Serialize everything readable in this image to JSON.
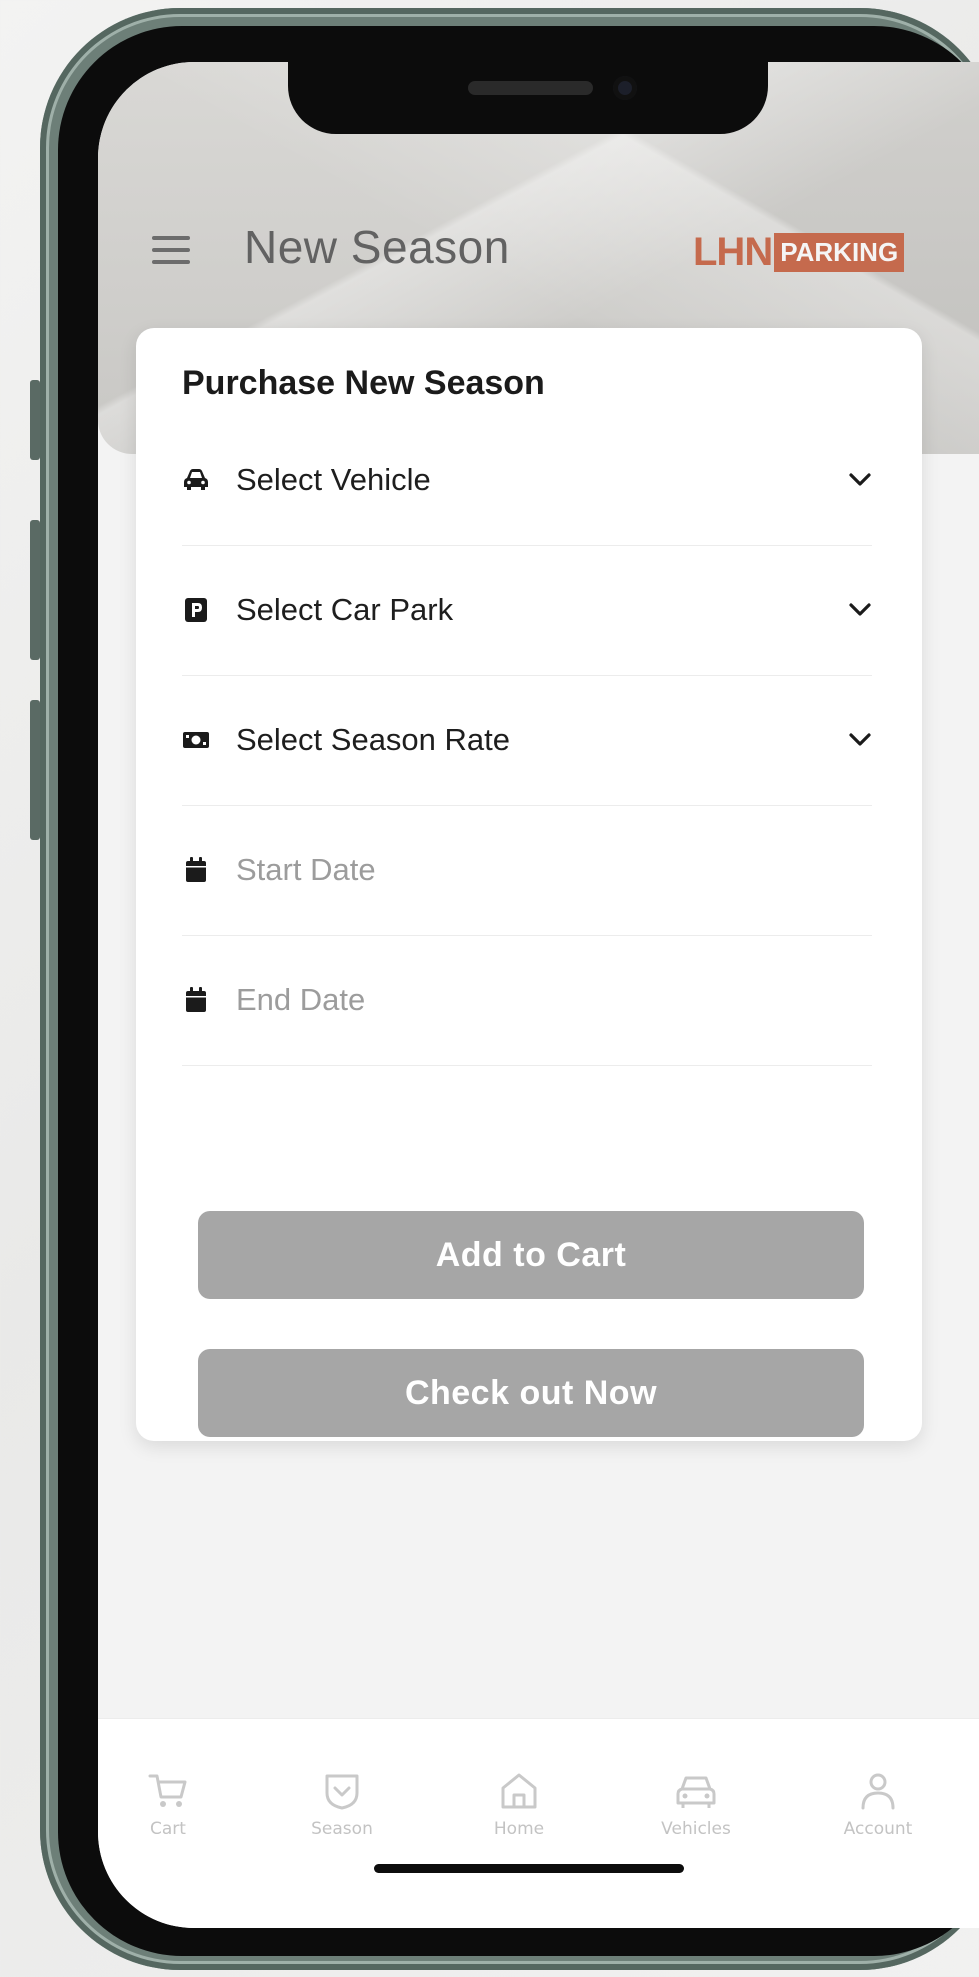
{
  "header": {
    "title": "New Season",
    "logo_brand": "LHN",
    "logo_sub": "PARKING",
    "menu_icon": "hamburger-menu-icon"
  },
  "card": {
    "title": "Purchase New Season",
    "fields": [
      {
        "label": "Select Vehicle",
        "icon": "car-icon",
        "type": "dropdown"
      },
      {
        "label": "Select Car Park",
        "icon": "parking-icon",
        "type": "dropdown"
      },
      {
        "label": "Select Season Rate",
        "icon": "money-icon",
        "type": "dropdown"
      },
      {
        "placeholder": "Start Date",
        "icon": "calendar-icon",
        "type": "date"
      },
      {
        "placeholder": "End Date",
        "icon": "calendar-icon",
        "type": "date"
      }
    ],
    "buttons": {
      "add_to_cart": "Add to Cart",
      "checkout": "Check out Now"
    }
  },
  "bottom_nav": [
    {
      "label": "Cart",
      "icon": "cart-icon"
    },
    {
      "label": "Season",
      "icon": "season-icon"
    },
    {
      "label": "Home",
      "icon": "home-icon"
    },
    {
      "label": "Vehicles",
      "icon": "vehicle-icon"
    },
    {
      "label": "Account",
      "icon": "account-icon"
    }
  ],
  "colors": {
    "brand": "#c56a4d",
    "button_disabled": "#a6a6a6",
    "placeholder_text": "#9c9c9c"
  }
}
